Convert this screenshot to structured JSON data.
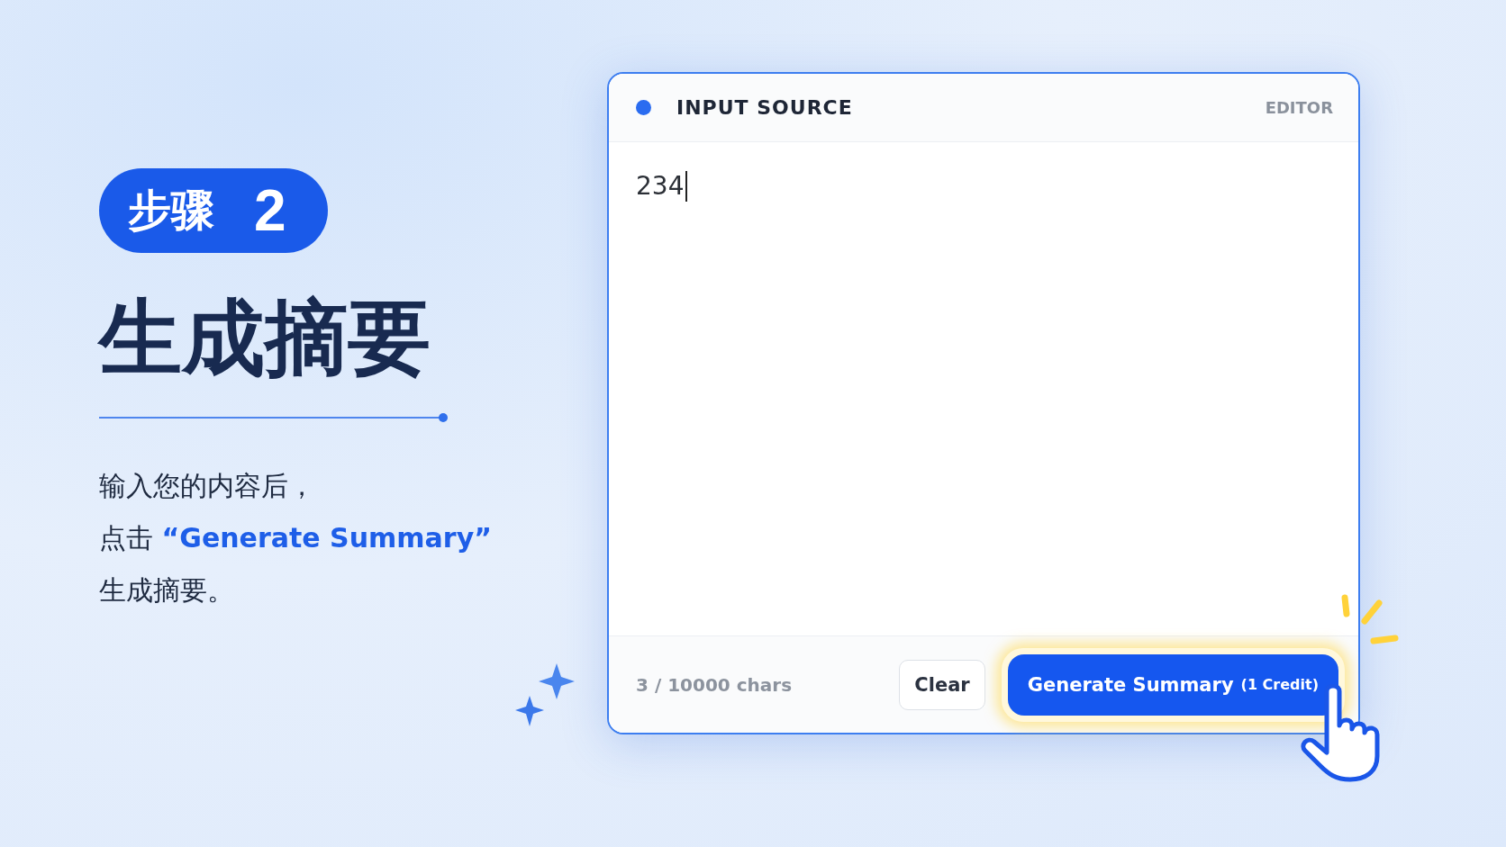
{
  "step_badge": {
    "label": "步骤",
    "number": "2"
  },
  "title": "生成摘要",
  "description": [
    "输入您的内容后，",
    "点击 **“Generate Summary”**",
    "生成摘要。"
  ],
  "editor": {
    "header": {
      "title": "INPUT SOURCE",
      "mode": "EDITOR"
    },
    "value": "234",
    "char_count": "3 / 10000 chars",
    "buttons": [
      {
        "kind": "secondary",
        "label": "Clear"
      },
      {
        "kind": "primary",
        "label": "Generate Summary",
        "note": "(1 Credit)"
      }
    ]
  }
}
